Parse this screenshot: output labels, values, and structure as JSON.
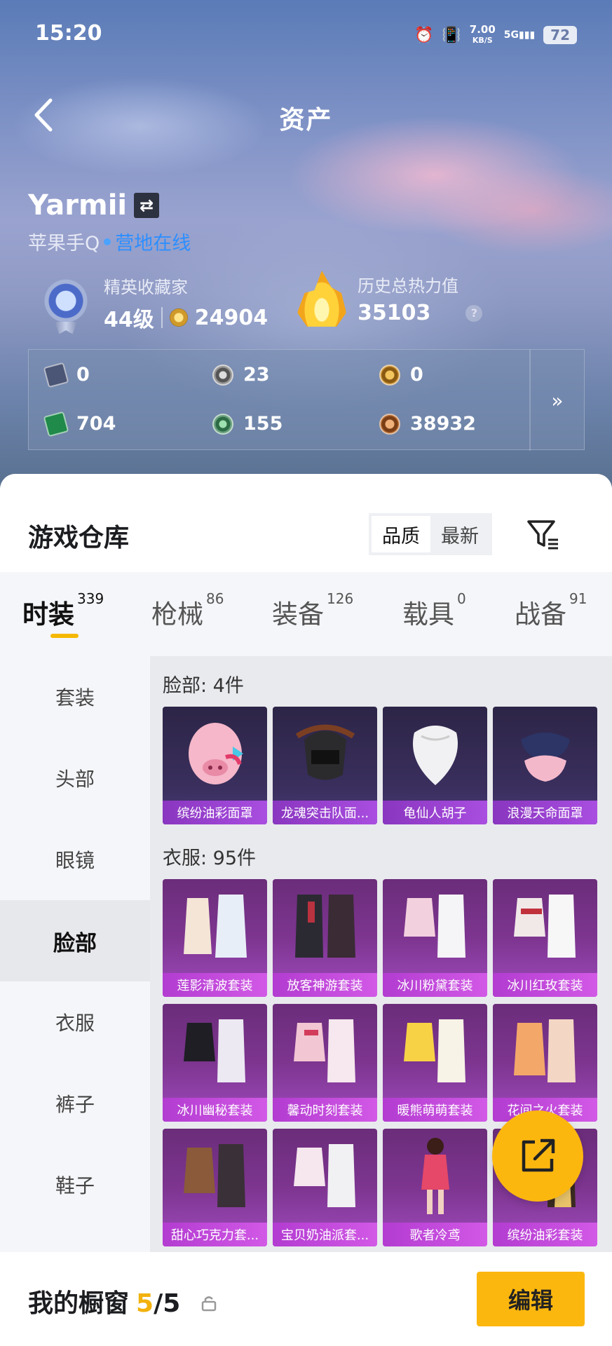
{
  "status_bar": {
    "time": "15:20",
    "speed_value": "7.00",
    "speed_unit": "KB/S",
    "network": "5G",
    "battery": "72"
  },
  "nav": {
    "title": "资产"
  },
  "profile": {
    "username": "Yarmii",
    "platform": "苹果手Q",
    "online_status": "营地在线"
  },
  "stats": {
    "collector_label": "精英收藏家",
    "collector_level": "44级",
    "collector_points": "24904",
    "heat_label": "历史总热力值",
    "heat_value": "35103",
    "help": "?"
  },
  "currencies": [
    {
      "icon": "card-icon",
      "value": "0"
    },
    {
      "icon": "silver-coin-icon",
      "value": "23"
    },
    {
      "icon": "gold-token-icon",
      "value": "0"
    },
    {
      "icon": "green-ticket-icon",
      "value": "704"
    },
    {
      "icon": "green-coin-icon",
      "value": "155"
    },
    {
      "icon": "bronze-coin-icon",
      "value": "38932"
    }
  ],
  "warehouse": {
    "title": "游戏仓库",
    "sort_options": [
      "品质",
      "最新"
    ],
    "sort_selected": "品质"
  },
  "category_tabs": [
    {
      "label": "时装",
      "count": "339",
      "active": true
    },
    {
      "label": "枪械",
      "count": "86"
    },
    {
      "label": "装备",
      "count": "126"
    },
    {
      "label": "载具",
      "count": "0"
    },
    {
      "label": "战备",
      "count": "91"
    }
  ],
  "sidebar": {
    "items": [
      "套装",
      "头部",
      "眼镜",
      "脸部",
      "衣服",
      "裤子",
      "鞋子"
    ],
    "active": "脸部"
  },
  "sections": {
    "face": {
      "title": "脸部: 4件",
      "items": [
        "缤纷油彩面罩",
        "龙魂突击队面...",
        "龟仙人胡子",
        "浪漫天命面罩"
      ]
    },
    "clothes": {
      "title": "衣服: 95件",
      "items": [
        "莲影清波套装",
        "放客神游套装",
        "冰川粉黛套装",
        "冰川红玫套装",
        "冰川幽秘套装",
        "馨动时刻套装",
        "暖熊萌萌套装",
        "花间之火套装",
        "甜心巧克力套...",
        "宝贝奶油派套...",
        "歌者冷鸢",
        "缤纷油彩套装"
      ]
    }
  },
  "showcase": {
    "title": "我的橱窗",
    "current": "5",
    "separator": "/",
    "total": "5",
    "edit_label": "编辑"
  },
  "colors": {
    "accent": "#fcb70f",
    "online": "#2d8fff",
    "card_label": "#c24ada"
  }
}
